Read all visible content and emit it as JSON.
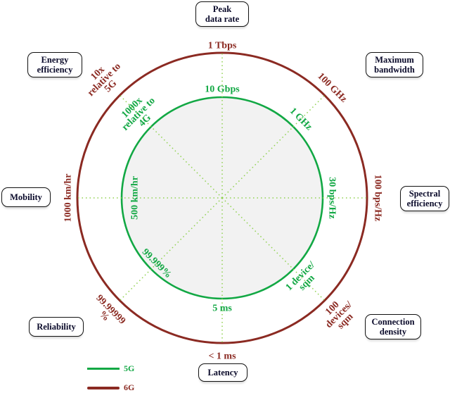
{
  "colors": {
    "5g": "#12a844",
    "6g": "#8b2a22",
    "guide": "#8fd14f",
    "fill": "#f2f2f2",
    "box_text": "#0a0a2a"
  },
  "kpis": [
    {
      "id": "peak",
      "label_lines": [
        "Peak",
        "data rate"
      ],
      "angle": 0,
      "val_5g": [
        "10 Gbps"
      ],
      "val_6g": [
        "1 Tbps"
      ]
    },
    {
      "id": "bw",
      "label_lines": [
        "Maximum",
        "bandwidth"
      ],
      "angle": 45,
      "val_5g": [
        "1 GHz"
      ],
      "val_6g": [
        "100 GHz"
      ]
    },
    {
      "id": "spec",
      "label_lines": [
        "Spectral",
        "efficiency"
      ],
      "angle": 90,
      "val_5g": [
        "30 bps/Hz"
      ],
      "val_6g": [
        "100 bps/Hz"
      ]
    },
    {
      "id": "conn",
      "label_lines": [
        "Connection",
        "density"
      ],
      "angle": 135,
      "val_5g": [
        "1 device/",
        "sqm"
      ],
      "val_6g": [
        "100",
        "devices/",
        "sqm"
      ]
    },
    {
      "id": "lat",
      "label_lines": [
        "Latency"
      ],
      "angle": 180,
      "val_5g": [
        "5 ms"
      ],
      "val_6g": [
        "< 1 ms"
      ]
    },
    {
      "id": "rel",
      "label_lines": [
        "Reliability"
      ],
      "angle": 225,
      "val_5g": [
        "99.999%"
      ],
      "val_6g": [
        "99.99999",
        "%"
      ]
    },
    {
      "id": "mob",
      "label_lines": [
        "Mobility"
      ],
      "angle": 270,
      "val_5g": [
        "500 km/hr"
      ],
      "val_6g": [
        "1000 km/hr"
      ]
    },
    {
      "id": "energy",
      "label_lines": [
        "Energy",
        "efficiency"
      ],
      "angle": 315,
      "val_5g": [
        "1000x",
        "relative to",
        "4G"
      ],
      "val_6g": [
        "10x",
        "relative to",
        "5G"
      ]
    }
  ],
  "legend": [
    {
      "label": "5G",
      "color_key": "5g"
    },
    {
      "label": "6G",
      "color_key": "6g"
    }
  ]
}
